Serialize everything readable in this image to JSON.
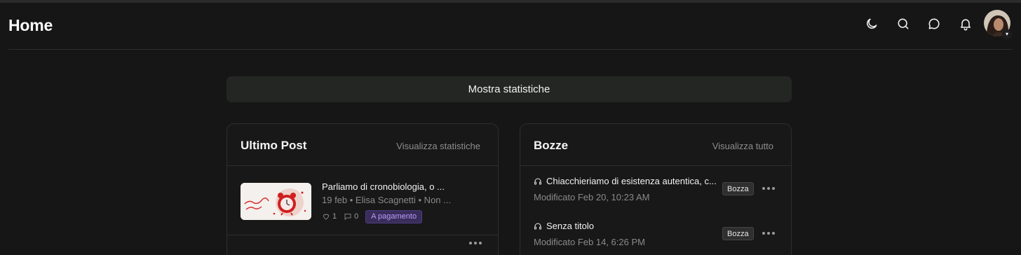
{
  "header": {
    "title": "Home",
    "icons": [
      "moon-icon",
      "search-icon",
      "chat-icon",
      "bell-icon"
    ],
    "avatar_caret": "▾"
  },
  "stats_button": {
    "label": "Mostra statistiche"
  },
  "latest_post": {
    "title": "Ultimo Post",
    "link": "Visualizza statistiche",
    "post": {
      "title": "Parliamo di cronobiologia, o ...",
      "meta": "19 feb • Elisa Scagnetti • Non ...",
      "likes": "1",
      "comments": "0",
      "badge": "A pagamento"
    }
  },
  "drafts": {
    "title": "Bozze",
    "link": "Visualizza tutto",
    "items": [
      {
        "title": "Chiacchieriamo di esistenza autentica, c...",
        "modified": "Modificato Feb 20, 10:23 AM",
        "badge": "Bozza",
        "icon": "headphones-icon"
      },
      {
        "title": "Senza titolo",
        "modified": "Modificato Feb 14, 6:26 PM",
        "badge": "Bozza",
        "icon": "headphones-icon"
      }
    ]
  },
  "colors": {
    "background": "#161616",
    "card": "#181818",
    "border": "#2e2e2e",
    "paid_badge_bg": "#3a2d5c",
    "paid_badge_text": "#b89cf5"
  }
}
